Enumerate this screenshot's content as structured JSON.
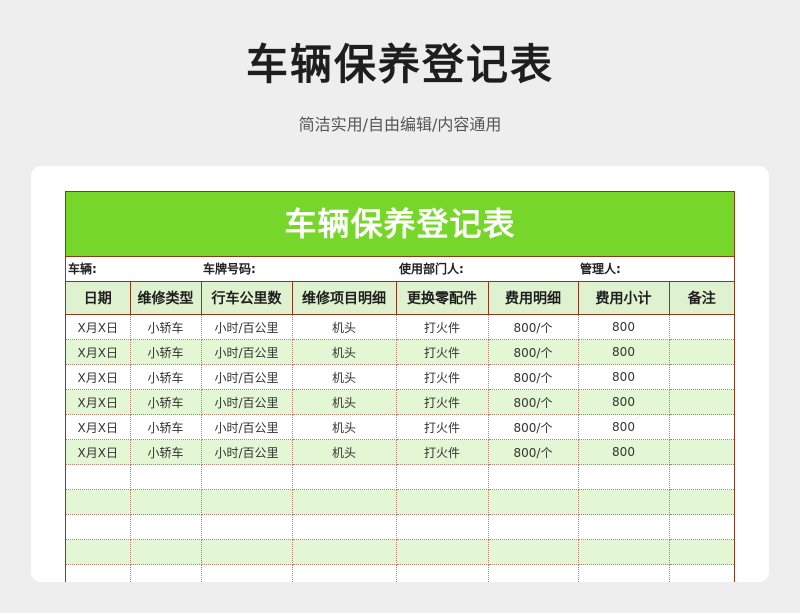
{
  "page": {
    "title": "车辆保养登记表",
    "subtitle": "简洁实用/自由编辑/内容通用"
  },
  "sheet": {
    "title": "车辆保养登记表",
    "info": {
      "vehicle_label": "车辆:",
      "plate_label": "车牌号码:",
      "department_label": "使用部门人:",
      "manager_label": "管理人:"
    },
    "columns": [
      "日期",
      "维修类型",
      "行车公里数",
      "维修项目明细",
      "更换零配件",
      "费用明细",
      "费用小计",
      "备注"
    ],
    "rows": [
      [
        "X月X日",
        "小轿车",
        "小时/百公里",
        "机头",
        "打火件",
        "800/个",
        "800",
        ""
      ],
      [
        "X月X日",
        "小轿车",
        "小时/百公里",
        "机头",
        "打火件",
        "800/个",
        "800",
        ""
      ],
      [
        "X月X日",
        "小轿车",
        "小时/百公里",
        "机头",
        "打火件",
        "800/个",
        "800",
        ""
      ],
      [
        "X月X日",
        "小轿车",
        "小时/百公里",
        "机头",
        "打火件",
        "800/个",
        "800",
        ""
      ],
      [
        "X月X日",
        "小轿车",
        "小时/百公里",
        "机头",
        "打火件",
        "800/个",
        "800",
        ""
      ],
      [
        "X月X日",
        "小轿车",
        "小时/百公里",
        "机头",
        "打火件",
        "800/个",
        "800",
        ""
      ],
      [
        "",
        "",
        "",
        "",
        "",
        "",
        "",
        ""
      ],
      [
        "",
        "",
        "",
        "",
        "",
        "",
        "",
        ""
      ],
      [
        "",
        "",
        "",
        "",
        "",
        "",
        "",
        ""
      ],
      [
        "",
        "",
        "",
        "",
        "",
        "",
        "",
        ""
      ],
      [
        "",
        "",
        "",
        "",
        "",
        "",
        "",
        ""
      ]
    ]
  },
  "colors": {
    "header_green": "#77d62a",
    "row_alt_green": "#e4f7d4",
    "border_brown": "#8a3a1a"
  }
}
